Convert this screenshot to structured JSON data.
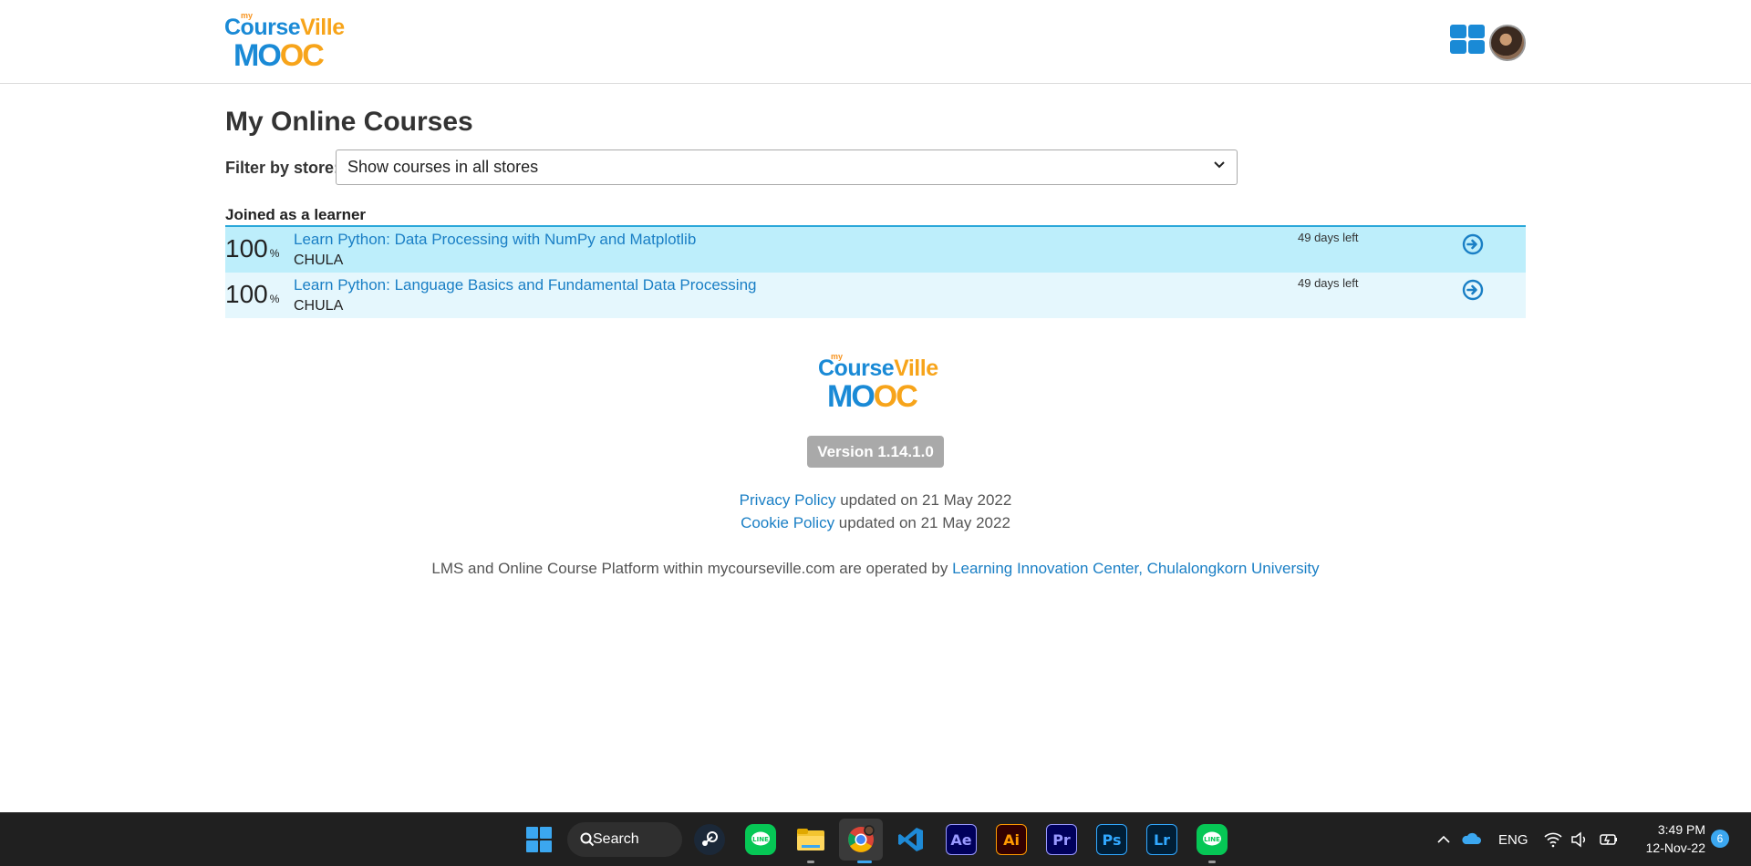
{
  "header": {
    "logo": {
      "my": "my",
      "course": "Course",
      "ville": "Ville",
      "mo": "MO",
      "oc": "OC"
    }
  },
  "main": {
    "title": "My Online Courses",
    "filter_label": "Filter by store:",
    "filter_value": "Show courses in all stores",
    "section_label": "Joined as a learner",
    "courses": [
      {
        "progress": "100",
        "progress_unit": "%",
        "title": "Learn Python: Data Processing with NumPy and Matplotlib",
        "org": "CHULA",
        "days_left": "49 days left"
      },
      {
        "progress": "100",
        "progress_unit": "%",
        "title": "Learn Python: Language Basics and Fundamental Data Processing",
        "org": "CHULA",
        "days_left": "49 days left"
      }
    ]
  },
  "footer": {
    "logo": {
      "my": "my",
      "course": "Course",
      "ville": "Ville",
      "mo": "MO",
      "oc": "OC"
    },
    "version": "Version 1.14.1.0",
    "privacy_link": "Privacy Policy",
    "privacy_text": " updated on 21 May 2022",
    "cookie_link": "Cookie Policy",
    "cookie_text": " updated on 21 May 2022",
    "operated_text": "LMS and Online Course Platform within mycourseville.com are operated by ",
    "operated_link": "Learning Innovation Center, Chulalongkorn University"
  },
  "taskbar": {
    "search_label": "Search",
    "apps": [
      {
        "name": "steam-icon",
        "label": ""
      },
      {
        "name": "line-icon",
        "label": ""
      },
      {
        "name": "file-explorer-icon",
        "label": ""
      },
      {
        "name": "chrome-icon",
        "label": ""
      },
      {
        "name": "vscode-icon",
        "label": ""
      },
      {
        "name": "after-effects-icon",
        "label": "Ae"
      },
      {
        "name": "illustrator-icon",
        "label": "Ai"
      },
      {
        "name": "premiere-icon",
        "label": "Pr"
      },
      {
        "name": "photoshop-icon",
        "label": "Ps"
      },
      {
        "name": "lightroom-icon",
        "label": "Lr"
      },
      {
        "name": "line-icon-2",
        "label": ""
      }
    ],
    "language": "ENG",
    "time": "3:49 PM",
    "date": "12-Nov-22",
    "notification_count": "6"
  },
  "colors": {
    "link": "#1a7fc5",
    "row_highlight": "#bdeefb",
    "row_light": "#e5f7fd",
    "brand_blue": "#1a8ad6",
    "brand_orange": "#f7a41a"
  }
}
